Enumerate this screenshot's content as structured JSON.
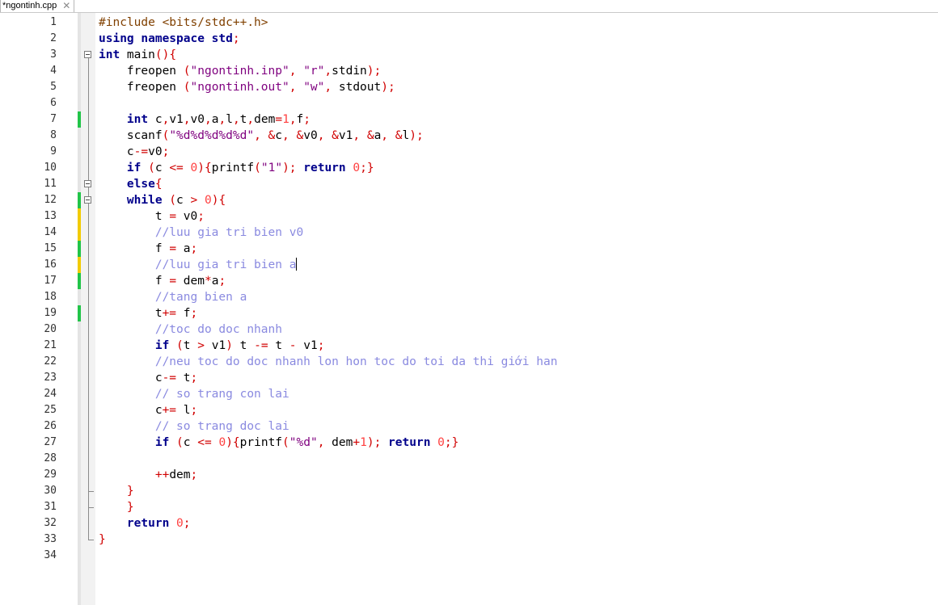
{
  "tab": {
    "title": "*ngontinh.cpp",
    "close_icon": "close-icon",
    "close_glyph": "✕"
  },
  "editor": {
    "lines": [
      {
        "n": "1",
        "chg": "",
        "fold": "",
        "tokens": [
          {
            "t": "#include <bits/stdc++.h>",
            "c": "pp"
          }
        ]
      },
      {
        "n": "2",
        "chg": "",
        "fold": "",
        "tokens": [
          {
            "t": "using namespace std",
            "c": "kw"
          },
          {
            "t": ";",
            "c": "op"
          }
        ]
      },
      {
        "n": "3",
        "chg": "",
        "fold": "open-start",
        "tokens": [
          {
            "t": "int",
            "c": "kw"
          },
          {
            "t": " main",
            "c": ""
          },
          {
            "t": "(){",
            "c": "op"
          }
        ]
      },
      {
        "n": "4",
        "chg": "",
        "fold": "line",
        "tokens": [
          {
            "t": "    freopen ",
            "c": ""
          },
          {
            "t": "(",
            "c": "op"
          },
          {
            "t": "\"ngontinh.inp\"",
            "c": "str"
          },
          {
            "t": ", ",
            "c": "op"
          },
          {
            "t": "\"r\"",
            "c": "str"
          },
          {
            "t": ",",
            "c": "op"
          },
          {
            "t": "stdin",
            "c": ""
          },
          {
            "t": ");",
            "c": "op"
          }
        ]
      },
      {
        "n": "5",
        "chg": "",
        "fold": "line",
        "tokens": [
          {
            "t": "    freopen ",
            "c": ""
          },
          {
            "t": "(",
            "c": "op"
          },
          {
            "t": "\"ngontinh.out\"",
            "c": "str"
          },
          {
            "t": ", ",
            "c": "op"
          },
          {
            "t": "\"w\"",
            "c": "str"
          },
          {
            "t": ", ",
            "c": "op"
          },
          {
            "t": "stdout",
            "c": ""
          },
          {
            "t": ");",
            "c": "op"
          }
        ]
      },
      {
        "n": "6",
        "chg": "",
        "fold": "line",
        "tokens": []
      },
      {
        "n": "7",
        "chg": "saved",
        "fold": "line",
        "tokens": [
          {
            "t": "    ",
            "c": ""
          },
          {
            "t": "int",
            "c": "kw"
          },
          {
            "t": " c",
            "c": ""
          },
          {
            "t": ",",
            "c": "op"
          },
          {
            "t": "v1",
            "c": ""
          },
          {
            "t": ",",
            "c": "op"
          },
          {
            "t": "v0",
            "c": ""
          },
          {
            "t": ",",
            "c": "op"
          },
          {
            "t": "a",
            "c": ""
          },
          {
            "t": ",",
            "c": "op"
          },
          {
            "t": "l",
            "c": ""
          },
          {
            "t": ",",
            "c": "op"
          },
          {
            "t": "t",
            "c": ""
          },
          {
            "t": ",",
            "c": "op"
          },
          {
            "t": "dem",
            "c": ""
          },
          {
            "t": "=",
            "c": "op"
          },
          {
            "t": "1",
            "c": "num"
          },
          {
            "t": ",",
            "c": "op"
          },
          {
            "t": "f",
            "c": ""
          },
          {
            "t": ";",
            "c": "op"
          }
        ]
      },
      {
        "n": "8",
        "chg": "",
        "fold": "line",
        "tokens": [
          {
            "t": "    scanf",
            "c": ""
          },
          {
            "t": "(",
            "c": "op"
          },
          {
            "t": "\"%d%d%d%d%d\"",
            "c": "str"
          },
          {
            "t": ", &",
            "c": "op"
          },
          {
            "t": "c",
            "c": ""
          },
          {
            "t": ", &",
            "c": "op"
          },
          {
            "t": "v0",
            "c": ""
          },
          {
            "t": ", &",
            "c": "op"
          },
          {
            "t": "v1",
            "c": ""
          },
          {
            "t": ", &",
            "c": "op"
          },
          {
            "t": "a",
            "c": ""
          },
          {
            "t": ", &",
            "c": "op"
          },
          {
            "t": "l",
            "c": ""
          },
          {
            "t": ");",
            "c": "op"
          }
        ]
      },
      {
        "n": "9",
        "chg": "",
        "fold": "line",
        "tokens": [
          {
            "t": "    c",
            "c": ""
          },
          {
            "t": "-=",
            "c": "op"
          },
          {
            "t": "v0",
            "c": ""
          },
          {
            "t": ";",
            "c": "op"
          }
        ]
      },
      {
        "n": "10",
        "chg": "",
        "fold": "line",
        "tokens": [
          {
            "t": "    ",
            "c": ""
          },
          {
            "t": "if",
            "c": "kw"
          },
          {
            "t": " (",
            "c": "op"
          },
          {
            "t": "c ",
            "c": ""
          },
          {
            "t": "<=",
            "c": "op"
          },
          {
            "t": " ",
            "c": ""
          },
          {
            "t": "0",
            "c": "num"
          },
          {
            "t": "){",
            "c": "op"
          },
          {
            "t": "printf",
            "c": ""
          },
          {
            "t": "(",
            "c": "op"
          },
          {
            "t": "\"1\"",
            "c": "str"
          },
          {
            "t": "); ",
            "c": "op"
          },
          {
            "t": "return",
            "c": "kw"
          },
          {
            "t": " ",
            "c": ""
          },
          {
            "t": "0",
            "c": "num"
          },
          {
            "t": ";}",
            "c": "op"
          }
        ]
      },
      {
        "n": "11",
        "chg": "",
        "fold": "open",
        "tokens": [
          {
            "t": "    ",
            "c": ""
          },
          {
            "t": "else",
            "c": "kw"
          },
          {
            "t": "{",
            "c": "op"
          }
        ]
      },
      {
        "n": "12",
        "chg": "saved",
        "fold": "open",
        "tokens": [
          {
            "t": "    ",
            "c": ""
          },
          {
            "t": "while",
            "c": "kw"
          },
          {
            "t": " (",
            "c": "op"
          },
          {
            "t": "c ",
            "c": ""
          },
          {
            "t": ">",
            "c": "op"
          },
          {
            "t": " ",
            "c": ""
          },
          {
            "t": "0",
            "c": "num"
          },
          {
            "t": "){",
            "c": "op"
          }
        ]
      },
      {
        "n": "13",
        "chg": "unsaved",
        "fold": "line",
        "tokens": [
          {
            "t": "        t ",
            "c": ""
          },
          {
            "t": "=",
            "c": "op"
          },
          {
            "t": " v0",
            "c": ""
          },
          {
            "t": ";",
            "c": "op"
          }
        ]
      },
      {
        "n": "14",
        "chg": "unsaved",
        "fold": "line",
        "tokens": [
          {
            "t": "        ",
            "c": ""
          },
          {
            "t": "//luu gia tri bien v0",
            "c": "cm"
          }
        ]
      },
      {
        "n": "15",
        "chg": "saved",
        "fold": "line",
        "tokens": [
          {
            "t": "        f ",
            "c": ""
          },
          {
            "t": "=",
            "c": "op"
          },
          {
            "t": " a",
            "c": ""
          },
          {
            "t": ";",
            "c": "op"
          }
        ]
      },
      {
        "n": "16",
        "chg": "unsaved",
        "fold": "line",
        "caret": true,
        "tokens": [
          {
            "t": "        ",
            "c": ""
          },
          {
            "t": "//luu gia tri bien a",
            "c": "cm"
          }
        ]
      },
      {
        "n": "17",
        "chg": "saved",
        "fold": "line",
        "tokens": [
          {
            "t": "        f ",
            "c": ""
          },
          {
            "t": "=",
            "c": "op"
          },
          {
            "t": " dem",
            "c": ""
          },
          {
            "t": "*",
            "c": "op"
          },
          {
            "t": "a",
            "c": ""
          },
          {
            "t": ";",
            "c": "op"
          }
        ]
      },
      {
        "n": "18",
        "chg": "",
        "fold": "line",
        "tokens": [
          {
            "t": "        ",
            "c": ""
          },
          {
            "t": "//tang bien a",
            "c": "cm"
          }
        ]
      },
      {
        "n": "19",
        "chg": "saved",
        "fold": "line",
        "tokens": [
          {
            "t": "        t",
            "c": ""
          },
          {
            "t": "+=",
            "c": "op"
          },
          {
            "t": " f",
            "c": ""
          },
          {
            "t": ";",
            "c": "op"
          }
        ]
      },
      {
        "n": "20",
        "chg": "",
        "fold": "line",
        "tokens": [
          {
            "t": "        ",
            "c": ""
          },
          {
            "t": "//toc do doc nhanh",
            "c": "cm"
          }
        ]
      },
      {
        "n": "21",
        "chg": "",
        "fold": "line",
        "tokens": [
          {
            "t": "        ",
            "c": ""
          },
          {
            "t": "if",
            "c": "kw"
          },
          {
            "t": " (",
            "c": "op"
          },
          {
            "t": "t ",
            "c": ""
          },
          {
            "t": ">",
            "c": "op"
          },
          {
            "t": " v1",
            "c": ""
          },
          {
            "t": ")",
            "c": "op"
          },
          {
            "t": " t ",
            "c": ""
          },
          {
            "t": "-=",
            "c": "op"
          },
          {
            "t": " t ",
            "c": ""
          },
          {
            "t": "-",
            "c": "op"
          },
          {
            "t": " v1",
            "c": ""
          },
          {
            "t": ";",
            "c": "op"
          }
        ]
      },
      {
        "n": "22",
        "chg": "",
        "fold": "line",
        "tokens": [
          {
            "t": "        ",
            "c": ""
          },
          {
            "t": "//neu toc do doc nhanh lon hon toc do toi da thi giới han",
            "c": "cm"
          }
        ]
      },
      {
        "n": "23",
        "chg": "",
        "fold": "line",
        "tokens": [
          {
            "t": "        c",
            "c": ""
          },
          {
            "t": "-=",
            "c": "op"
          },
          {
            "t": " t",
            "c": ""
          },
          {
            "t": ";",
            "c": "op"
          }
        ]
      },
      {
        "n": "24",
        "chg": "",
        "fold": "line",
        "tokens": [
          {
            "t": "        ",
            "c": ""
          },
          {
            "t": "// so trang con lai",
            "c": "cm"
          }
        ]
      },
      {
        "n": "25",
        "chg": "",
        "fold": "line",
        "tokens": [
          {
            "t": "        c",
            "c": ""
          },
          {
            "t": "+=",
            "c": "op"
          },
          {
            "t": " l",
            "c": ""
          },
          {
            "t": ";",
            "c": "op"
          }
        ]
      },
      {
        "n": "26",
        "chg": "",
        "fold": "line",
        "tokens": [
          {
            "t": "        ",
            "c": ""
          },
          {
            "t": "// so trang doc lai",
            "c": "cm"
          }
        ]
      },
      {
        "n": "27",
        "chg": "",
        "fold": "line",
        "tokens": [
          {
            "t": "        ",
            "c": ""
          },
          {
            "t": "if",
            "c": "kw"
          },
          {
            "t": " (",
            "c": "op"
          },
          {
            "t": "c ",
            "c": ""
          },
          {
            "t": "<=",
            "c": "op"
          },
          {
            "t": " ",
            "c": ""
          },
          {
            "t": "0",
            "c": "num"
          },
          {
            "t": "){",
            "c": "op"
          },
          {
            "t": "printf",
            "c": ""
          },
          {
            "t": "(",
            "c": "op"
          },
          {
            "t": "\"%d\"",
            "c": "str"
          },
          {
            "t": ", ",
            "c": "op"
          },
          {
            "t": "dem",
            "c": ""
          },
          {
            "t": "+",
            "c": "op"
          },
          {
            "t": "1",
            "c": "num"
          },
          {
            "t": "); ",
            "c": "op"
          },
          {
            "t": "return",
            "c": "kw"
          },
          {
            "t": " ",
            "c": ""
          },
          {
            "t": "0",
            "c": "num"
          },
          {
            "t": ";}",
            "c": "op"
          }
        ]
      },
      {
        "n": "28",
        "chg": "",
        "fold": "line",
        "tokens": []
      },
      {
        "n": "29",
        "chg": "",
        "fold": "line",
        "tokens": [
          {
            "t": "        ",
            "c": ""
          },
          {
            "t": "++",
            "c": "op"
          },
          {
            "t": "dem",
            "c": ""
          },
          {
            "t": ";",
            "c": "op"
          }
        ]
      },
      {
        "n": "30",
        "chg": "",
        "fold": "end",
        "tokens": [
          {
            "t": "    ",
            "c": ""
          },
          {
            "t": "}",
            "c": "op"
          }
        ]
      },
      {
        "n": "31",
        "chg": "",
        "fold": "end",
        "tokens": [
          {
            "t": "    ",
            "c": ""
          },
          {
            "t": "}",
            "c": "op"
          }
        ]
      },
      {
        "n": "32",
        "chg": "",
        "fold": "line",
        "tokens": [
          {
            "t": "    ",
            "c": ""
          },
          {
            "t": "return",
            "c": "kw"
          },
          {
            "t": " ",
            "c": ""
          },
          {
            "t": "0",
            "c": "num"
          },
          {
            "t": ";",
            "c": "op"
          }
        ]
      },
      {
        "n": "33",
        "chg": "",
        "fold": "end",
        "tokens": [
          {
            "t": "}",
            "c": "op"
          }
        ]
      },
      {
        "n": "34",
        "chg": "",
        "fold": "",
        "tokens": []
      }
    ]
  }
}
